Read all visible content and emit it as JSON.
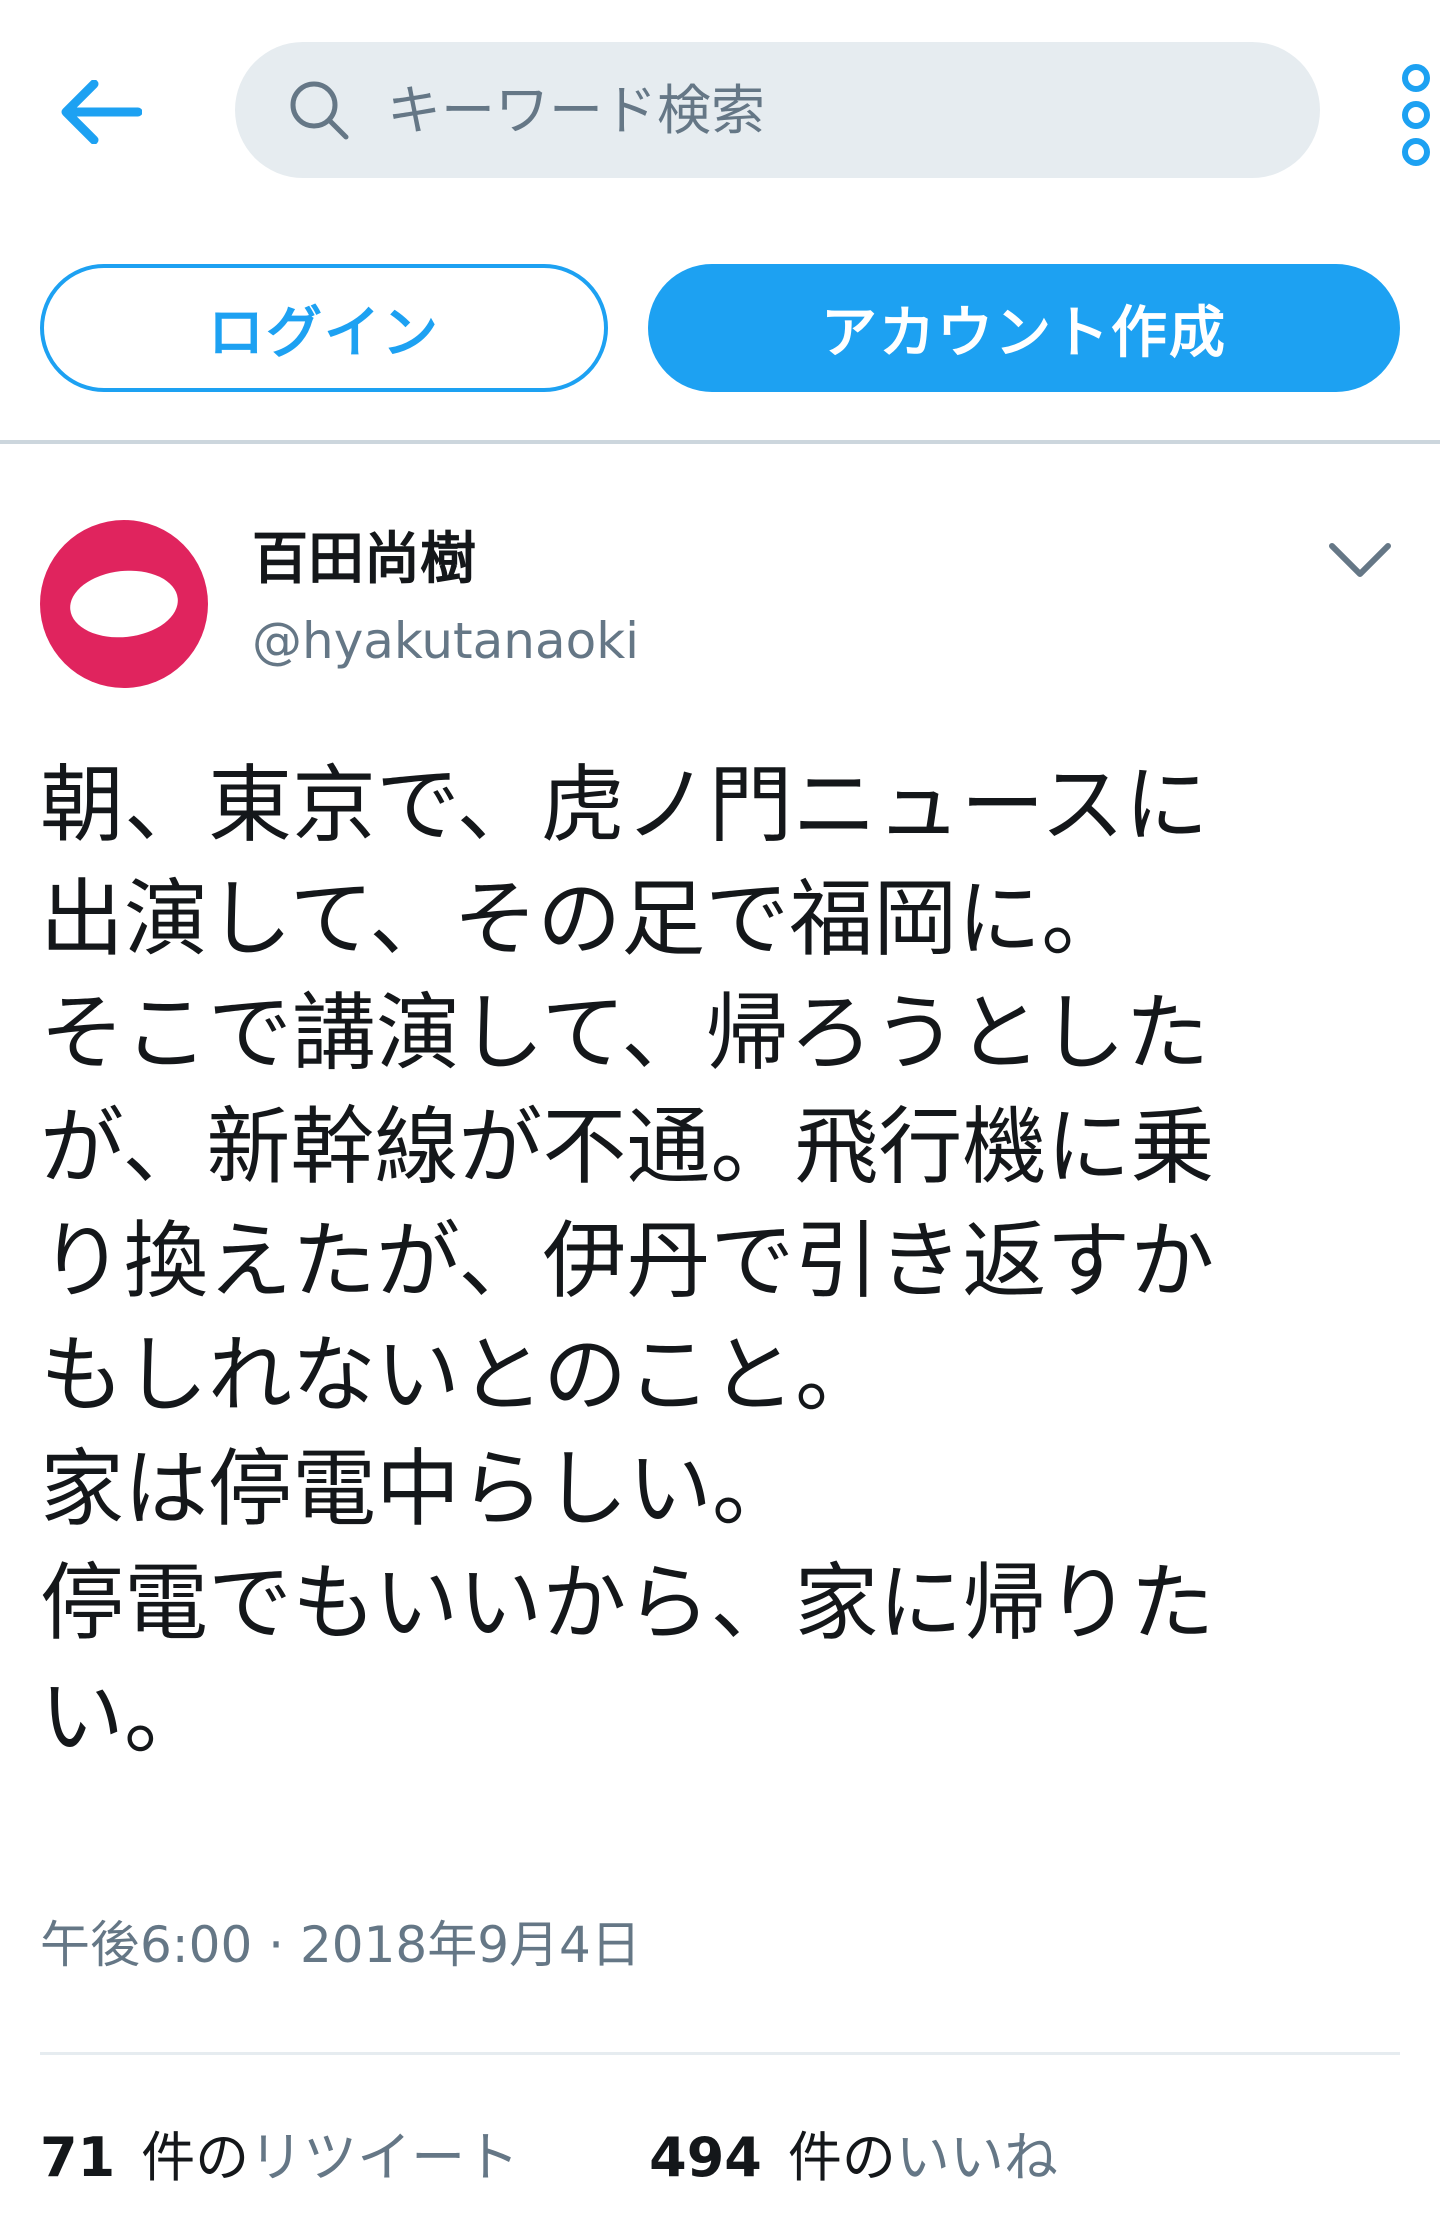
{
  "header": {
    "search_placeholder": "キーワード検索"
  },
  "auth": {
    "login_label": "ログイン",
    "signup_label": "アカウント作成"
  },
  "tweet": {
    "display_name": "百田尚樹",
    "handle": "@hyakutanaoki",
    "text": "朝、東京で、虎ノ門ニュースに\n出演して、その足で福岡に。\nそこで講演して、帰ろうとした\nが、新幹線が不通。飛行機に乗\nり換えたが、伊丹で引き返すか\nもしれないとのこと。\n家は停電中らしい。\n停電でもいいから、家に帰りた\nい。",
    "timestamp": "午後6:00 · 2018年9月4日",
    "retweets": {
      "count": "71",
      "unit": "件の",
      "label": "リツイート"
    },
    "likes": {
      "count": "494",
      "unit": "件の",
      "label": "いいね"
    }
  },
  "colors": {
    "accent": "#1da1f2",
    "avatar_bg": "#e0245e",
    "secondary_text": "#657786",
    "search_bg": "#e6ecf0"
  },
  "icons": [
    "back-arrow-icon",
    "search-icon",
    "more-vertical-icon",
    "avatar-logo-icon",
    "chevron-down-icon"
  ]
}
